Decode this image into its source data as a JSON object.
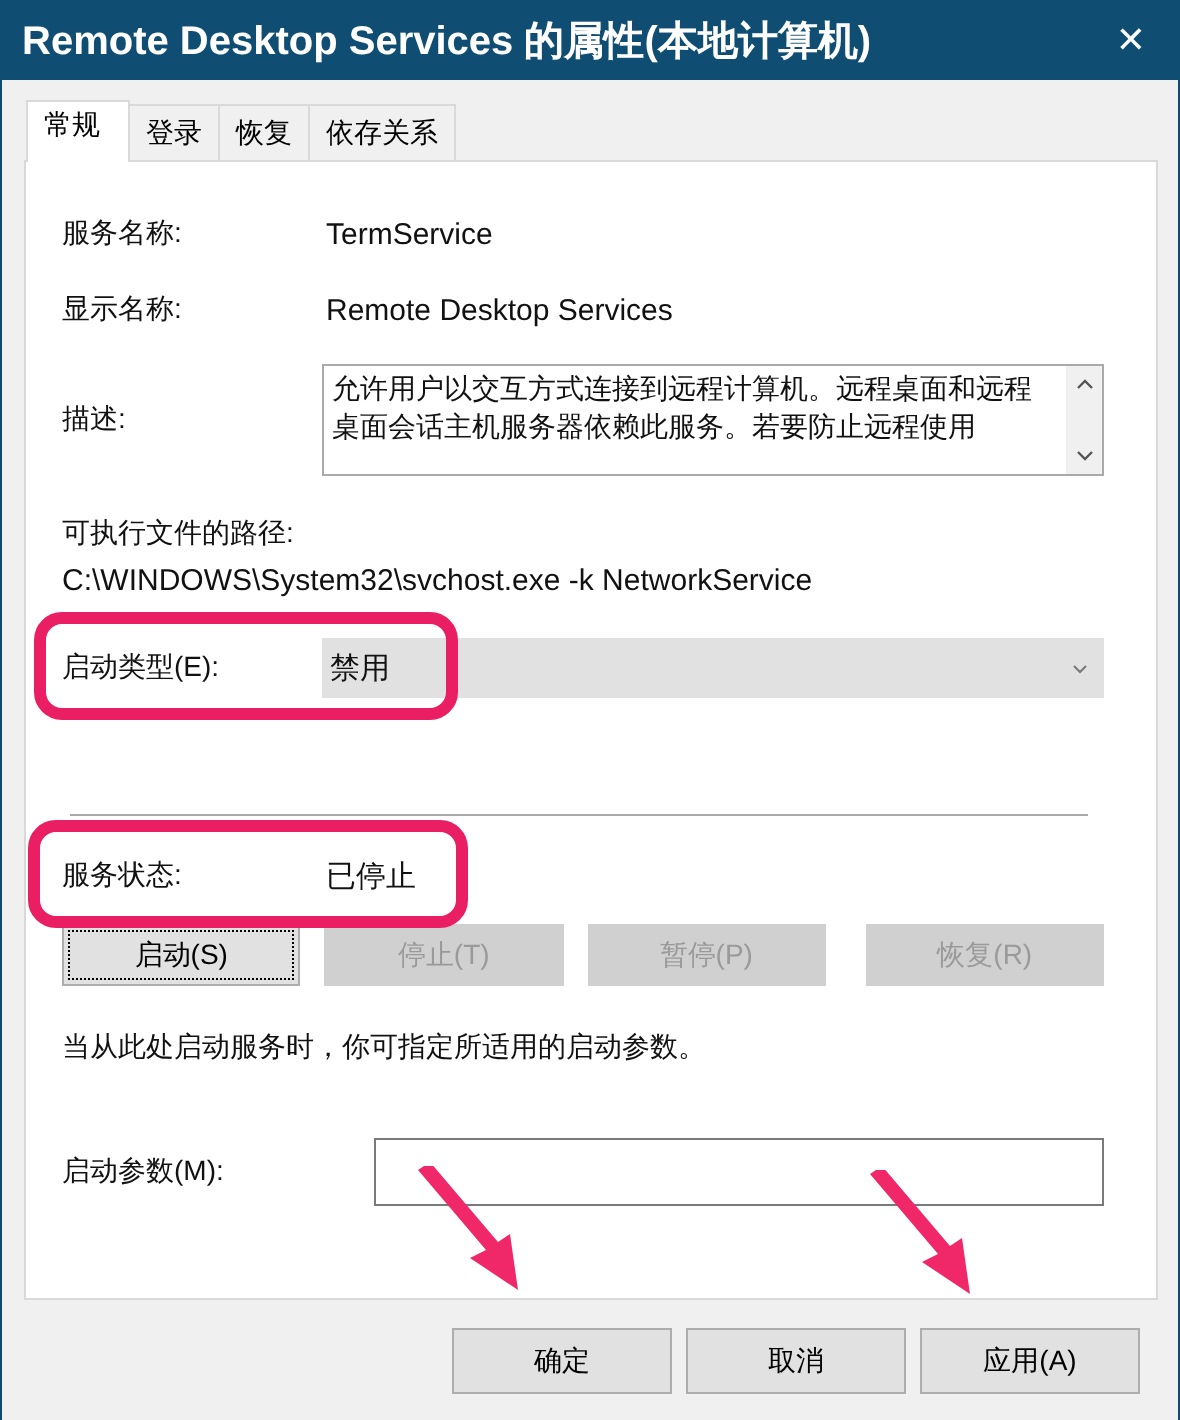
{
  "window": {
    "title": "Remote Desktop Services 的属性(本地计算机)",
    "close": "✕"
  },
  "tabs": [
    {
      "label": "常规",
      "selected": true
    },
    {
      "label": "登录",
      "selected": false
    },
    {
      "label": "恢复",
      "selected": false
    },
    {
      "label": "依存关系",
      "selected": false
    }
  ],
  "general": {
    "service_name": {
      "label": "服务名称:",
      "value": "TermService"
    },
    "display_name": {
      "label": "显示名称:",
      "value": "Remote Desktop Services"
    },
    "description": {
      "label": "描述:",
      "text": "允许用户以交互方式连接到远程计算机。远程桌面和远程桌面会话主机服务器依赖此服务。若要防止远程使用"
    },
    "path": {
      "label": "可执行文件的路径:",
      "value": "C:\\WINDOWS\\System32\\svchost.exe -k NetworkService"
    },
    "startup_type": {
      "label": "启动类型(E):",
      "value": "禁用"
    },
    "service_status": {
      "label": "服务状态:",
      "value": "已停止"
    },
    "status_buttons": [
      {
        "label": "启动(S)",
        "disabled": false,
        "focused": true
      },
      {
        "label": "停止(T)",
        "disabled": true,
        "focused": false
      },
      {
        "label": "暂停(P)",
        "disabled": true,
        "focused": false
      },
      {
        "label": "恢复(R)",
        "disabled": true,
        "focused": false
      }
    ],
    "hint": "当从此处启动服务时，你可指定所适用的启动参数。",
    "start_parameters": {
      "label": "启动参数(M):"
    }
  },
  "buttons": [
    {
      "label": "确定"
    },
    {
      "label": "取消"
    },
    {
      "label": "应用(A)"
    }
  ]
}
